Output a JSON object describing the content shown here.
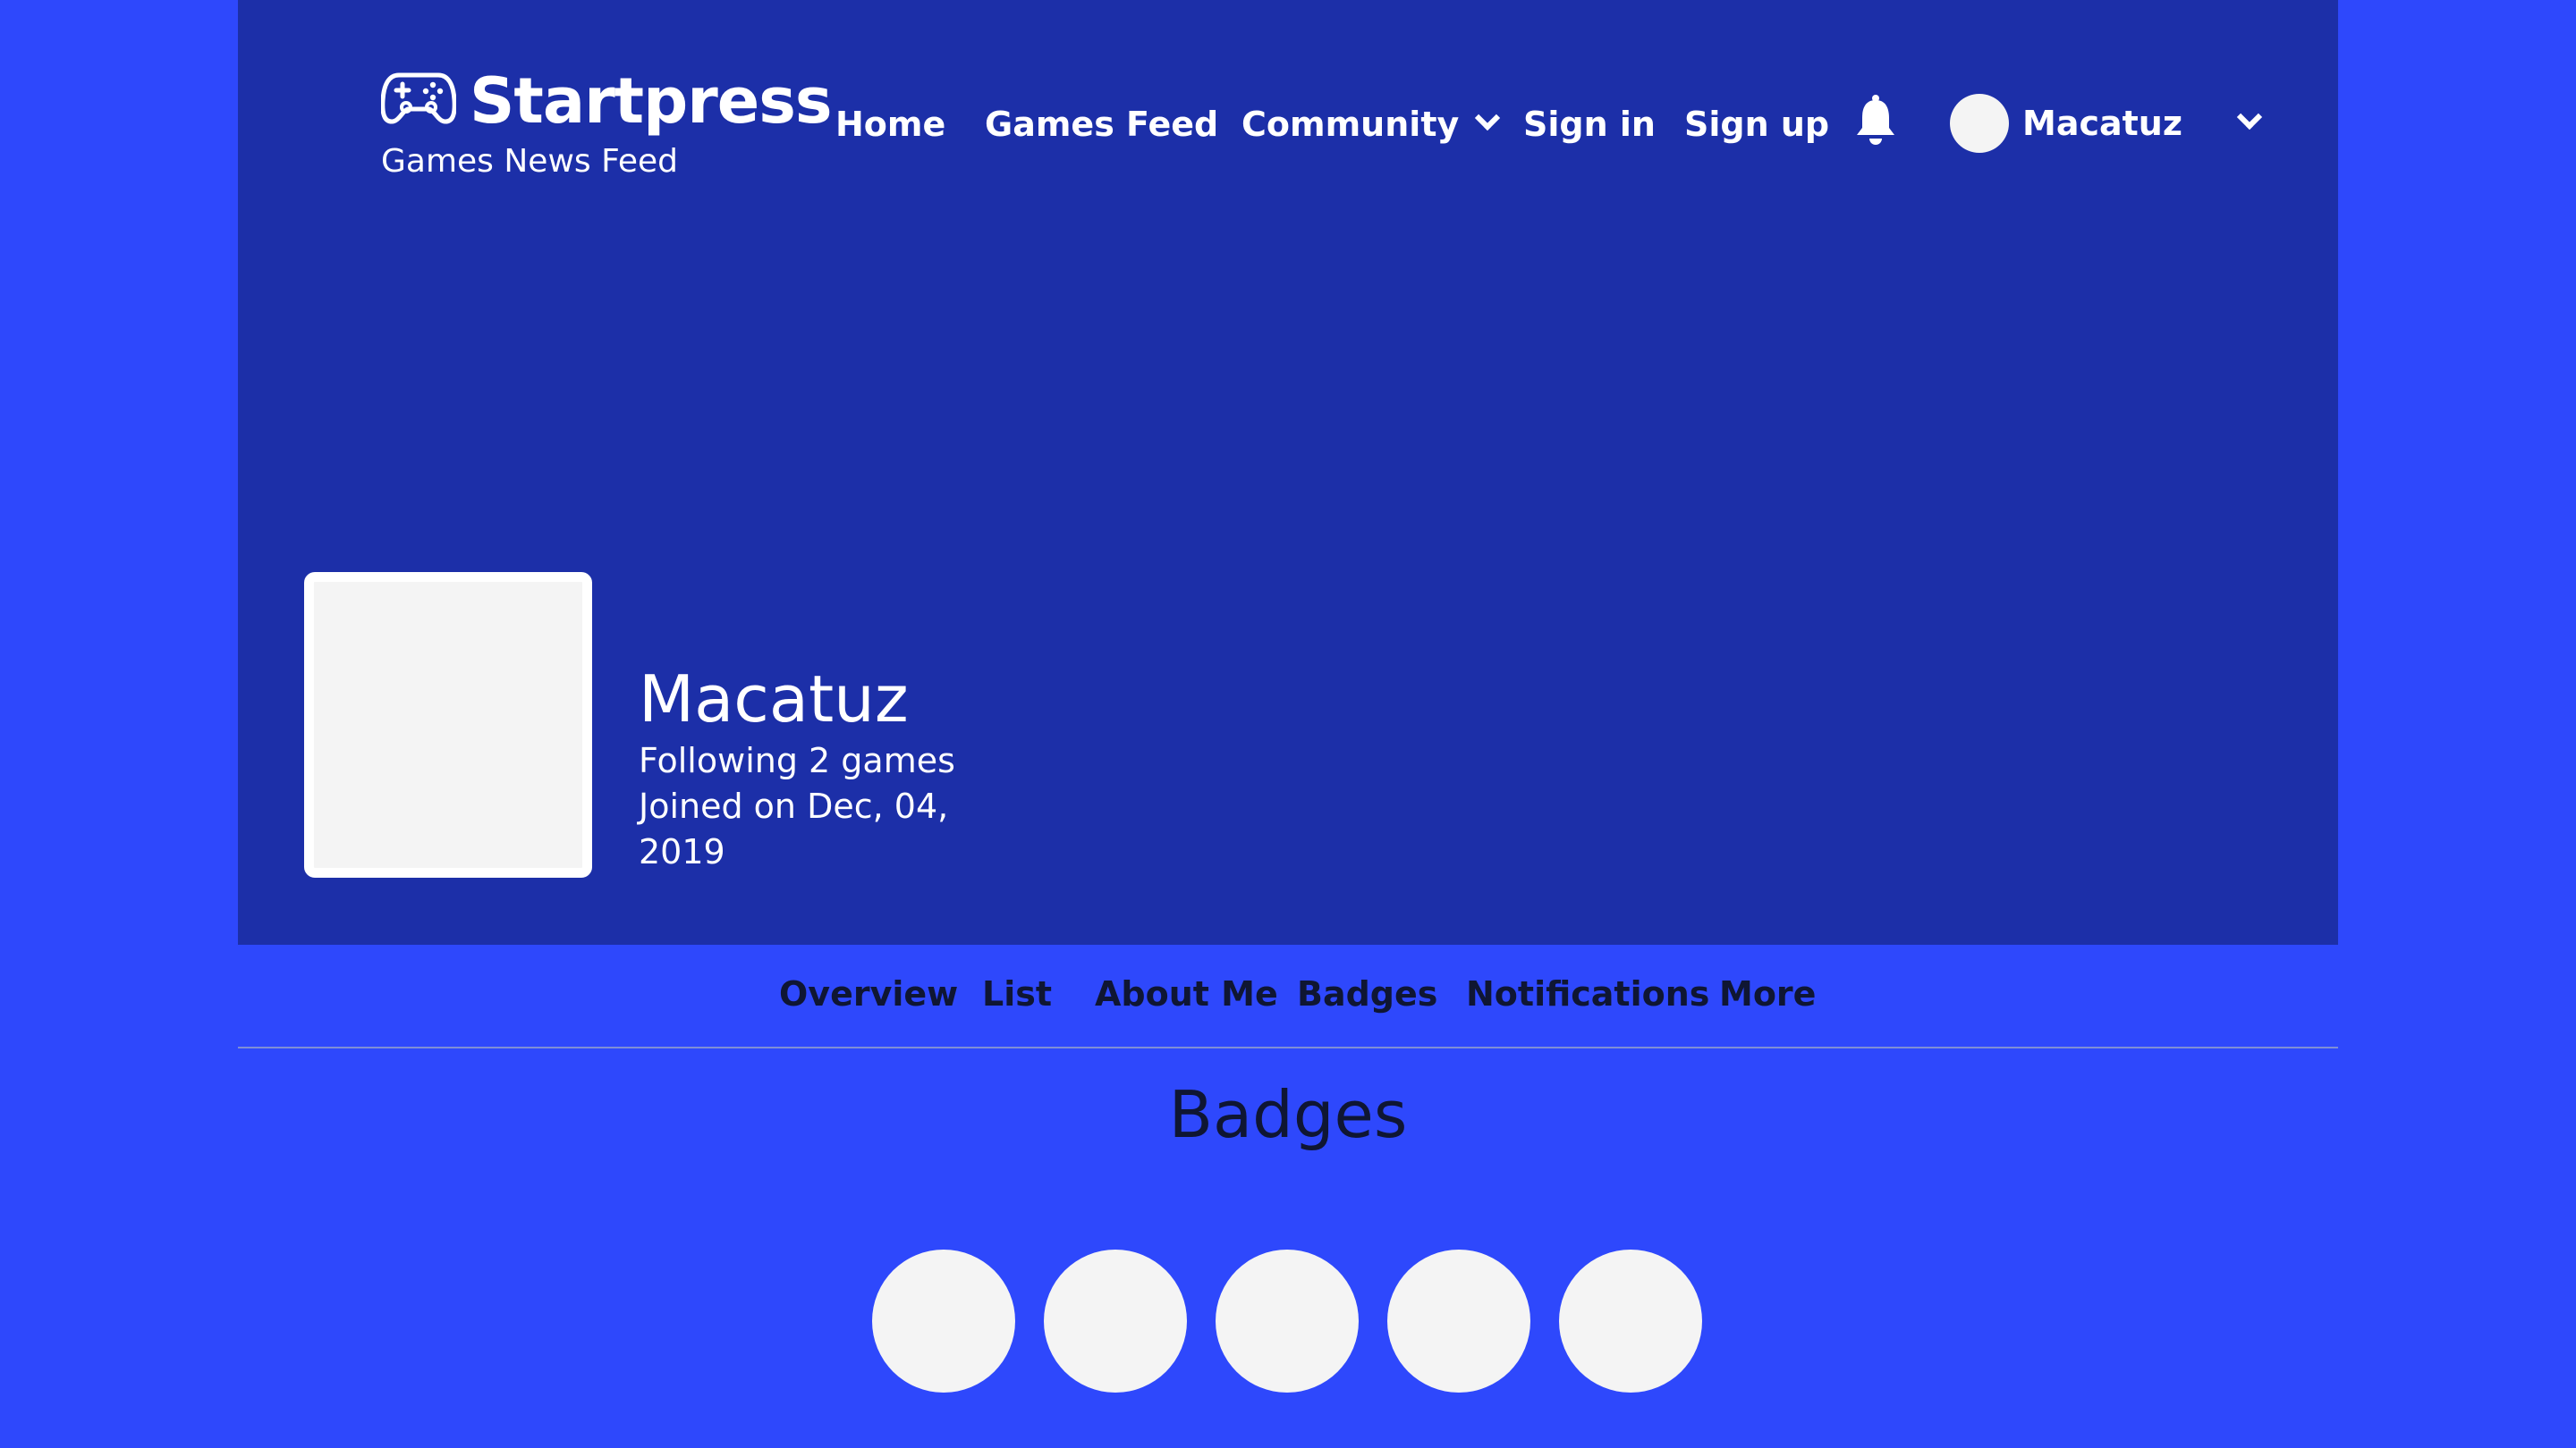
{
  "brand": {
    "name": "Startpress",
    "tagline": "Games News Feed",
    "logo_icon": "gamepad-icon"
  },
  "nav": {
    "home": "Home",
    "games_feed": "Games Feed",
    "community": "Community",
    "sign_in": "Sign in",
    "sign_up": "Sign up",
    "notifications_icon": "bell-icon",
    "user": "Macatuz"
  },
  "profile": {
    "name": "Macatuz",
    "following": "Following 2 games",
    "joined": "Joined on Dec, 04, 2019"
  },
  "tabs": [
    {
      "label": "Overview"
    },
    {
      "label": "List"
    },
    {
      "label": "About Me"
    },
    {
      "label": "Badges"
    },
    {
      "label": "Notifications"
    },
    {
      "label": "More"
    }
  ],
  "section": {
    "title": "Badges"
  },
  "colors": {
    "page_background": "#2e48fc",
    "hero_background": "#1c2fa8",
    "placeholder": "#f4f4f4",
    "tab_text": "#0f1633"
  }
}
